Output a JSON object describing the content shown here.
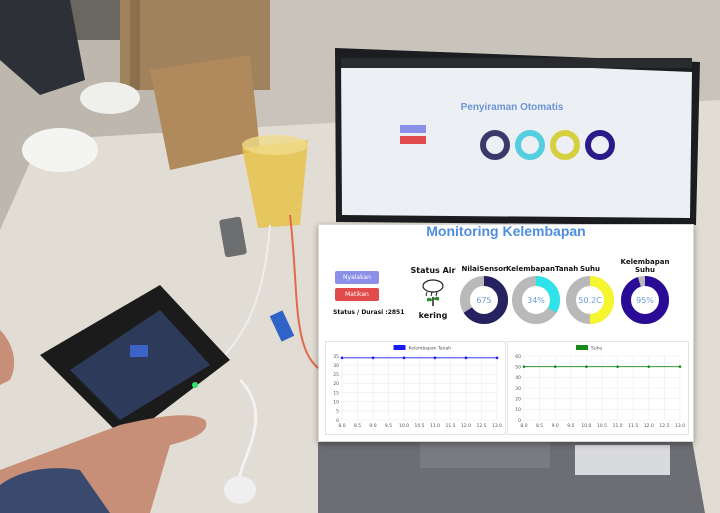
{
  "laptop_screen": {
    "title": "Penyiraman Otomatis"
  },
  "dashboard": {
    "title": "Monitoring Kelembapan",
    "buttons": {
      "on_label": "Nyalakan",
      "off_label": "Matikan",
      "on_color": "#8c8fe8",
      "off_color": "#e24b4b"
    },
    "status_duration": "Status / Durasi :2851",
    "status_air": {
      "heading": "Status Air",
      "state": "kering",
      "icon": "plant-rain-icon"
    },
    "gauges": [
      {
        "label": "NilaiSensor",
        "value_text": "675",
        "fill": 0.66,
        "color": "#25225f",
        "text_color": "#6e9bd8"
      },
      {
        "label": "KelembapanTanah",
        "value_text": "34%",
        "fill": 0.34,
        "color": "#2fe3ea",
        "text_color": "#6e9bd8"
      },
      {
        "label": "Suhu",
        "value_text": "50.2C",
        "fill": 0.5,
        "color": "#f5f530",
        "text_color": "#6e9bd8"
      },
      {
        "label": "Kelembapan\nSuhu",
        "value_text": "95%",
        "fill": 0.95,
        "color": "#2a0b96",
        "text_color": "#6e9bd8"
      }
    ]
  },
  "chart_data": [
    {
      "type": "line",
      "series": [
        {
          "name": "Kelembapan Tanah",
          "color": "#1a1aff",
          "x": [
            8.0,
            9.0,
            10.0,
            11.0,
            12.0,
            13.0
          ],
          "values": [
            34,
            34,
            34,
            34,
            34,
            34
          ]
        }
      ],
      "x_ticks": [
        "8.0",
        "8.5",
        "9.0",
        "9.5",
        "10.0",
        "10.5",
        "11.0",
        "11.5",
        "12.0",
        "12.5",
        "13.0"
      ],
      "y_ticks": [
        "0",
        "5",
        "10",
        "15",
        "20",
        "25",
        "30",
        "35"
      ],
      "xlim": [
        8.0,
        13.0
      ],
      "ylim": [
        0,
        35
      ],
      "grid": true,
      "legend": "top"
    },
    {
      "type": "line",
      "series": [
        {
          "name": "Suhu",
          "color": "#1a8a1a",
          "x": [
            8.0,
            9.0,
            10.0,
            11.0,
            12.0,
            13.0
          ],
          "values": [
            50,
            50,
            50,
            50,
            50,
            50
          ]
        }
      ],
      "x_ticks": [
        "8.0",
        "8.5",
        "9.0",
        "9.5",
        "10.0",
        "10.5",
        "11.0",
        "11.5",
        "12.0",
        "12.5",
        "13.0"
      ],
      "y_ticks": [
        "0",
        "10",
        "20",
        "30",
        "40",
        "50",
        "60"
      ],
      "xlim": [
        8.0,
        13.0
      ],
      "ylim": [
        0,
        60
      ],
      "grid": true,
      "legend": "top"
    }
  ]
}
